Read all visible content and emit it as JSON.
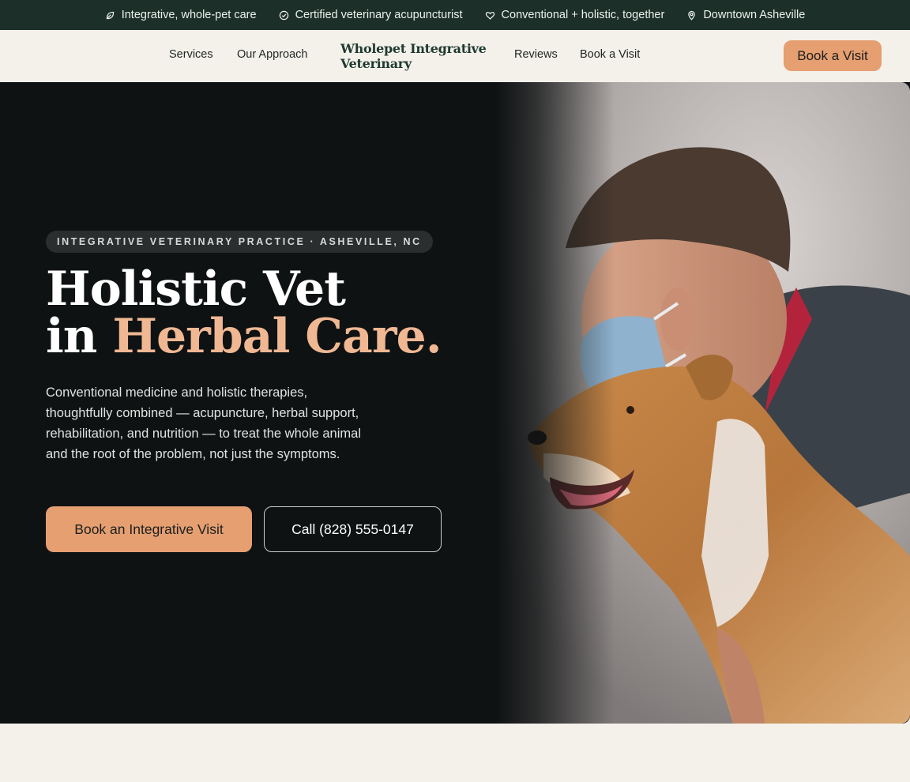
{
  "topbar": {
    "items": [
      {
        "icon": "leaf-icon",
        "label": "Integrative, whole-pet care"
      },
      {
        "icon": "check-circle-icon",
        "label": "Certified veterinary acupuncturist"
      },
      {
        "icon": "heart-icon",
        "label": "Conventional + holistic, together"
      },
      {
        "icon": "map-pin-icon",
        "label": "Downtown Asheville"
      }
    ]
  },
  "nav": {
    "links": [
      "Services",
      "Our Approach",
      "Reviews",
      "Book a Visit"
    ],
    "brand_line1": "Wholepet Integrative",
    "brand_line2": "Veterinary",
    "cta": "Book a Visit"
  },
  "hero": {
    "eyebrow": "INTEGRATIVE VETERINARY PRACTICE · ASHEVILLE, NC",
    "headline_line1": "Holistic Vet",
    "headline_in": "in",
    "headline_accent": "Herbal Care.",
    "lede": "Conventional medicine and holistic therapies, thoughtfully combined — acupuncture, herbal support, rehabilitation, and nutrition — to treat the whole animal and the root of the problem, not just the symptoms.",
    "primary_cta": "Book an Integrative Visit",
    "secondary_cta": "Call (828) 555-0147",
    "photo_subject": "vet-with-dog-photo"
  },
  "colors": {
    "topbar_bg": "#1c3029",
    "page_bg": "#f4f1ea",
    "hero_bg": "#0f1213",
    "accent": "#e59f71",
    "accent_text": "#efb893"
  }
}
